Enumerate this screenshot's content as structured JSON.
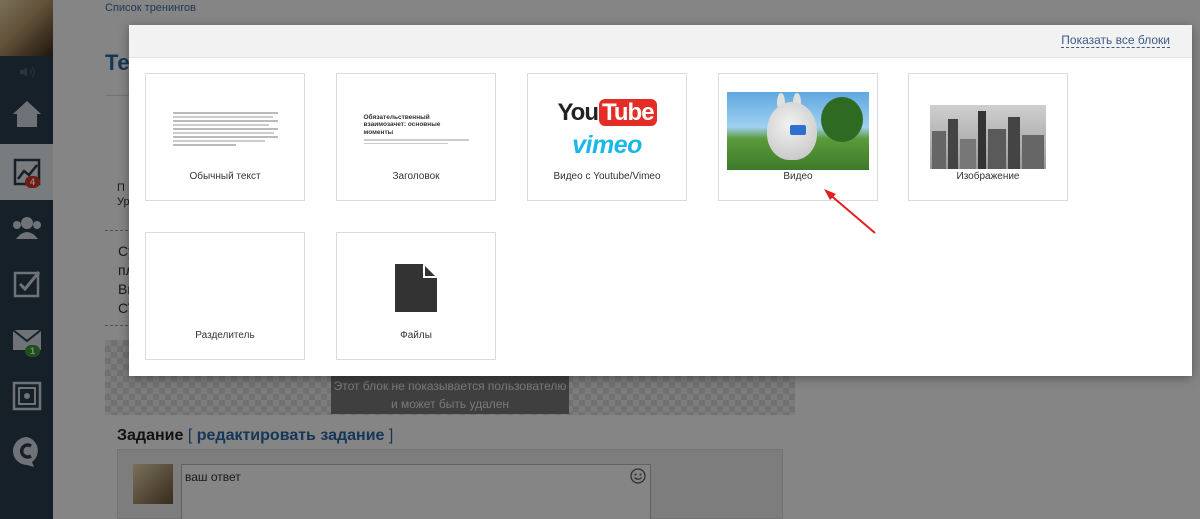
{
  "background": {
    "breadcrumb": "Список тренингов",
    "title_fragment": "Те",
    "card_label_1": "П",
    "card_label_2": "Ур",
    "text_lines": [
      "Су",
      "пл",
      "Вь",
      "СТ"
    ],
    "hidden_note": "Этот блок не показывается пользователю и может быть удален",
    "task_heading": "Задание",
    "task_open": "[",
    "task_link": "редактировать задание",
    "task_close": "]",
    "answer_placeholder": "ваш ответ"
  },
  "sidebar": {
    "badges": {
      "trainings": "4",
      "messages": "1"
    },
    "icons": [
      "sound-icon",
      "home-icon",
      "chart-icon",
      "users-icon",
      "checklist-icon",
      "mail-icon",
      "safe-icon",
      "c-logo-icon"
    ]
  },
  "modal": {
    "show_all_label": "Показать все блоки",
    "blocks": [
      {
        "label": "Обычный текст"
      },
      {
        "label": "Заголовок",
        "preview_heading": "Обязательственный взаимозачет: основные моменты"
      },
      {
        "label": "Видео с Youtube/Vimeo",
        "logo_youtube_1": "You",
        "logo_youtube_2": "Tube",
        "logo_vimeo": "vimeo"
      },
      {
        "label": "Видео"
      },
      {
        "label": "Изображение"
      },
      {
        "label": "Разделитель"
      },
      {
        "label": "Файлы"
      }
    ]
  },
  "colors": {
    "sidebar_bg": "#2b3e50",
    "link": "#2a6aa8",
    "annotation_arrow": "#e02020",
    "badge_red": "#d9342b",
    "badge_green": "#3a9a3a"
  }
}
